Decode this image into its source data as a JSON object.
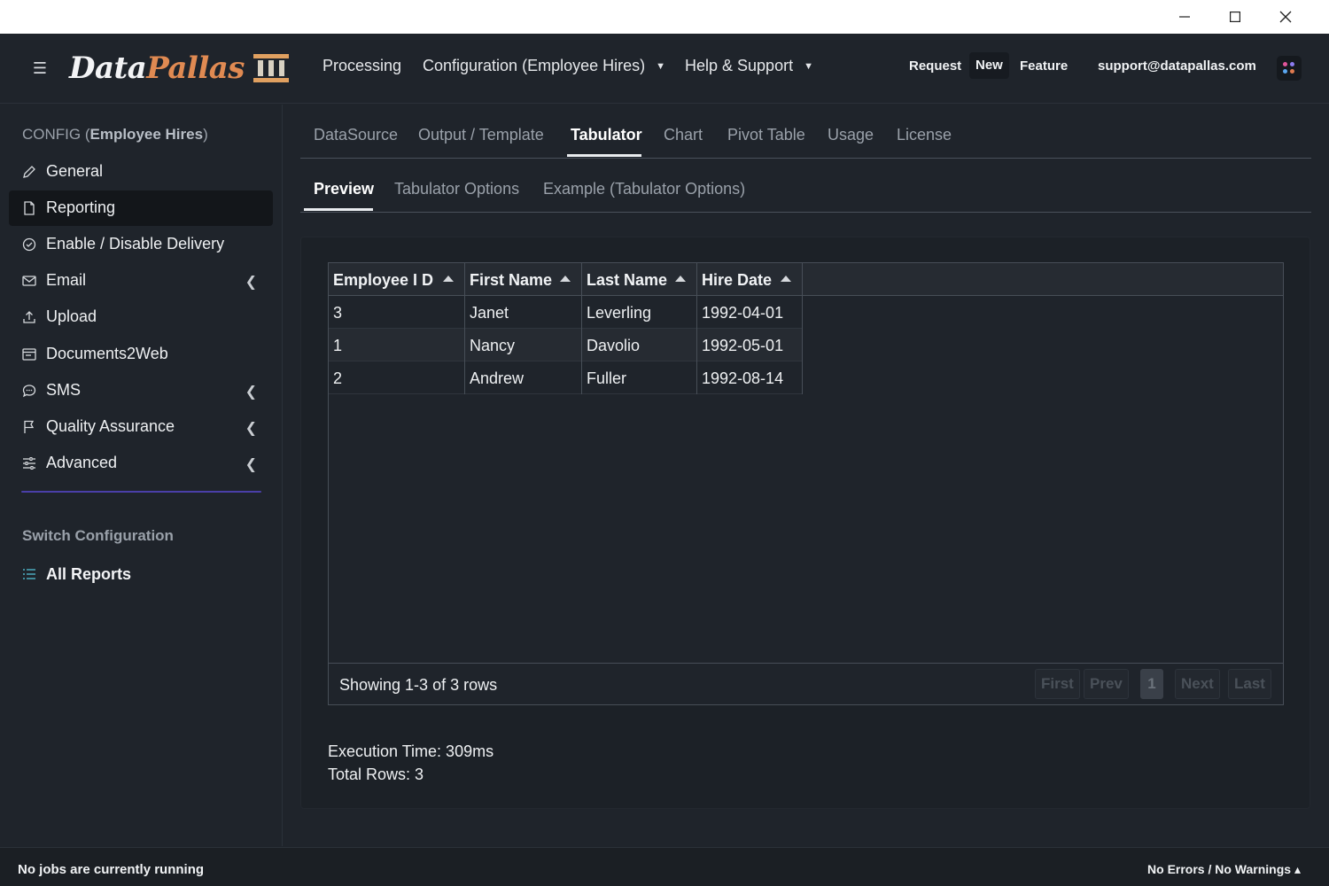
{
  "window": {
    "minimize_icon": "minimize-icon",
    "maximize_icon": "maximize-icon",
    "close_icon": "close-icon"
  },
  "navbar": {
    "menu_icon": "hamburger-icon",
    "brand_part1": "Data",
    "brand_part2": "Pallas",
    "links": {
      "processing": "Processing",
      "configuration": "Configuration (Employee Hires)",
      "help": "Help & Support"
    },
    "request": "Request",
    "new": "New",
    "feature": "Feature",
    "email": "support@datapallas.com",
    "apps_icon": "apps-grid-icon"
  },
  "sidebar": {
    "config_prefix": "CONFIG (",
    "config_name": "Employee Hires",
    "config_suffix": ")",
    "items": [
      {
        "label": "General",
        "icon": "pencil-icon"
      },
      {
        "label": "Reporting",
        "icon": "document-icon"
      },
      {
        "label": "Enable / Disable Delivery",
        "icon": "check-circle-icon"
      },
      {
        "label": "Email",
        "icon": "envelope-icon"
      },
      {
        "label": "Upload",
        "icon": "upload-icon"
      },
      {
        "label": "Documents2Web",
        "icon": "browser-icon"
      },
      {
        "label": "SMS",
        "icon": "chat-icon"
      },
      {
        "label": "Quality Assurance",
        "icon": "flag-icon"
      },
      {
        "label": "Advanced",
        "icon": "sliders-icon"
      }
    ],
    "switch_title": "Switch Configuration",
    "all_reports": "All Reports"
  },
  "tabs": [
    "DataSource",
    "Output / Template",
    "Tabulator",
    "Chart",
    "Pivot Table",
    "Usage",
    "License"
  ],
  "active_tab": "Tabulator",
  "subtabs": [
    "Preview",
    "Tabulator Options",
    "Example (Tabulator Options)"
  ],
  "active_subtab": "Preview",
  "table": {
    "columns": [
      "Employee I D",
      "First Name",
      "Last Name",
      "Hire Date"
    ],
    "rows": [
      [
        "3",
        "Janet",
        "Leverling",
        "1992-04-01"
      ],
      [
        "1",
        "Nancy",
        "Davolio",
        "1992-05-01"
      ],
      [
        "2",
        "Andrew",
        "Fuller",
        "1992-08-14"
      ]
    ],
    "footer_info": "Showing 1-3 of 3 rows",
    "pagination": {
      "first": "First",
      "prev": "Prev",
      "page": "1",
      "next": "Next",
      "last": "Last"
    }
  },
  "stats": {
    "execution_time": "Execution Time: 309ms",
    "total_rows": "Total Rows: 3"
  },
  "statusbar": {
    "left": "No jobs are currently running",
    "right": "No Errors / No Warnings ▴"
  }
}
